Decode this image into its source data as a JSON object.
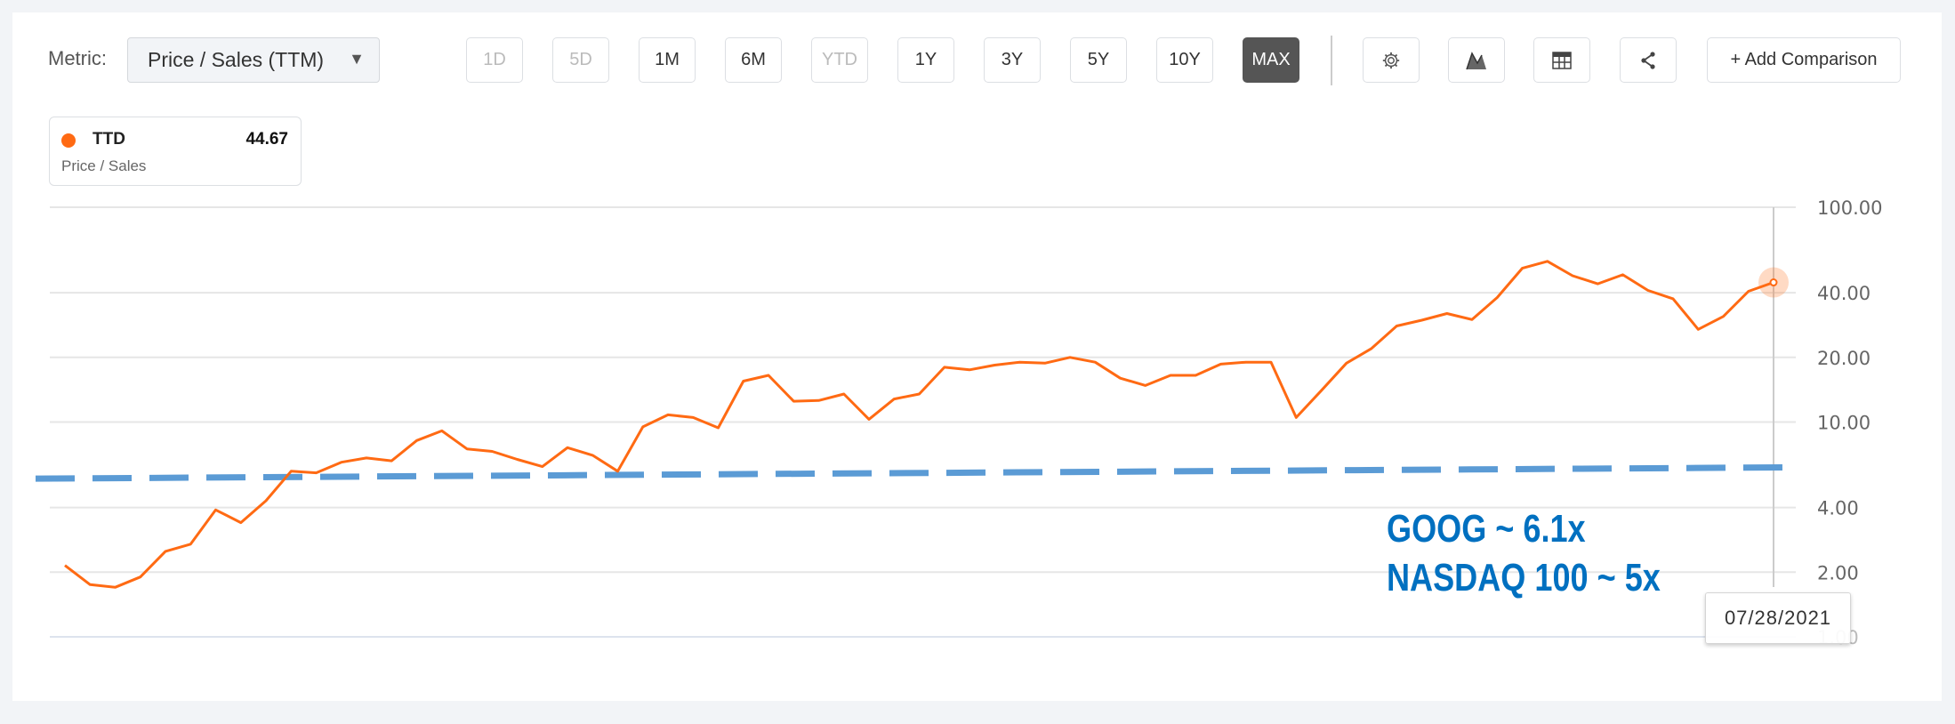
{
  "toolbar": {
    "metric_label": "Metric:",
    "metric_selected": "Price / Sales (TTM)",
    "ranges": [
      {
        "label": "1D",
        "state": "disabled"
      },
      {
        "label": "5D",
        "state": "disabled"
      },
      {
        "label": "1M",
        "state": "enabled"
      },
      {
        "label": "6M",
        "state": "enabled"
      },
      {
        "label": "YTD",
        "state": "disabled"
      },
      {
        "label": "1Y",
        "state": "enabled"
      },
      {
        "label": "3Y",
        "state": "enabled"
      },
      {
        "label": "5Y",
        "state": "enabled"
      },
      {
        "label": "10Y",
        "state": "enabled"
      },
      {
        "label": "MAX",
        "state": "active"
      }
    ],
    "icons": [
      "gear-icon",
      "area-chart-icon",
      "table-icon",
      "share-icon"
    ],
    "add_comparison": "+ Add Comparison"
  },
  "legend": {
    "symbol": "TTD",
    "value": "44.67",
    "subtitle": "Price / Sales",
    "color": "#ff6a13"
  },
  "annotations": [
    "GOOG ~ 6.1x",
    "NASDAQ 100 ~ 5x"
  ],
  "tooltip": {
    "date": "07/28/2021"
  },
  "chart_data": {
    "type": "line",
    "title": "",
    "y_scale": "log",
    "ylim": [
      1,
      100
    ],
    "y_ticks": [
      "100.00",
      "40.00",
      "20.00",
      "10.00",
      "4.00",
      "2.00",
      "1.00"
    ],
    "y_tick_values": [
      100,
      40,
      20,
      10,
      4,
      2,
      1
    ],
    "grid": true,
    "series": [
      {
        "name": "TTD",
        "color": "#ff6a13",
        "end_date": "07/28/2021",
        "values": [
          2.15,
          1.75,
          1.7,
          1.9,
          2.5,
          2.7,
          3.9,
          3.4,
          4.3,
          5.9,
          5.8,
          6.5,
          6.8,
          6.6,
          8.2,
          9.1,
          7.5,
          7.3,
          6.7,
          6.2,
          7.6,
          7.0,
          5.9,
          9.5,
          10.8,
          10.5,
          9.4,
          15.5,
          16.5,
          12.5,
          12.6,
          13.5,
          10.3,
          12.8,
          13.5,
          18,
          17.5,
          18.4,
          19,
          18.8,
          20,
          19,
          16,
          14.8,
          16.5,
          16.5,
          18.6,
          19,
          19,
          10.5,
          14,
          18.8,
          22,
          28,
          29.8,
          32,
          30,
          38,
          52,
          56,
          48,
          44,
          48.5,
          41,
          37.5,
          27,
          31,
          40.6,
          44.67
        ]
      }
    ],
    "reference_line": {
      "start": 5.45,
      "end": 6.15,
      "color": "#5b9bd5",
      "style": "dashed"
    }
  }
}
